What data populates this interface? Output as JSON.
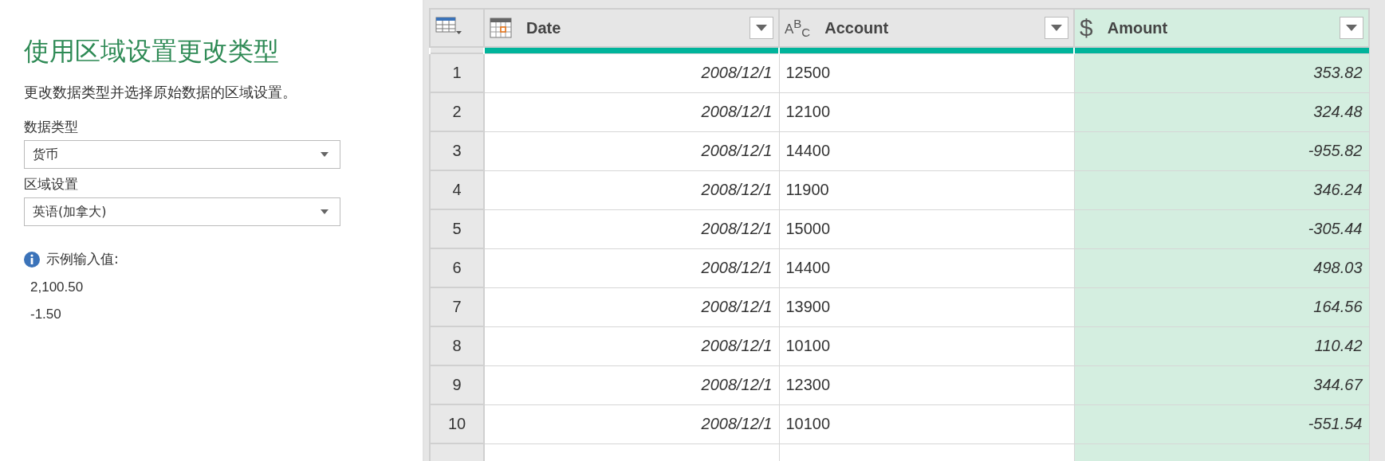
{
  "panel": {
    "title": "使用区域设置更改类型",
    "description": "更改数据类型并选择原始数据的区域设置。",
    "fields": [
      {
        "label": "数据类型",
        "value": "货币"
      },
      {
        "label": "区域设置",
        "value": "英语(加拿大)"
      }
    ],
    "info": {
      "label": "示例输入值:",
      "examples": [
        "2,100.50",
        "-1.50"
      ]
    }
  },
  "table": {
    "columns": [
      {
        "name": "Date",
        "kind": "date",
        "selected": false
      },
      {
        "name": "Account",
        "kind": "text",
        "type_glyph": "A$^{B}$$_{C}$",
        "selected": false
      },
      {
        "name": "Amount",
        "kind": "currency",
        "type_glyph": "$",
        "selected": true
      }
    ],
    "rows": [
      {
        "index": "1",
        "cells": [
          "2008/12/1",
          "12500",
          "353.82"
        ]
      },
      {
        "index": "2",
        "cells": [
          "2008/12/1",
          "12100",
          "324.48"
        ]
      },
      {
        "index": "3",
        "cells": [
          "2008/12/1",
          "14400",
          "-955.82"
        ]
      },
      {
        "index": "4",
        "cells": [
          "2008/12/1",
          "11900",
          "346.24"
        ]
      },
      {
        "index": "5",
        "cells": [
          "2008/12/1",
          "15000",
          "-305.44"
        ]
      },
      {
        "index": "6",
        "cells": [
          "2008/12/1",
          "14400",
          "498.03"
        ]
      },
      {
        "index": "7",
        "cells": [
          "2008/12/1",
          "13900",
          "164.56"
        ]
      },
      {
        "index": "8",
        "cells": [
          "2008/12/1",
          "10100",
          "110.42"
        ]
      },
      {
        "index": "9",
        "cells": [
          "2008/12/1",
          "12300",
          "344.67"
        ]
      },
      {
        "index": "10",
        "cells": [
          "2008/12/1",
          "10100",
          "-551.54"
        ]
      }
    ]
  }
}
